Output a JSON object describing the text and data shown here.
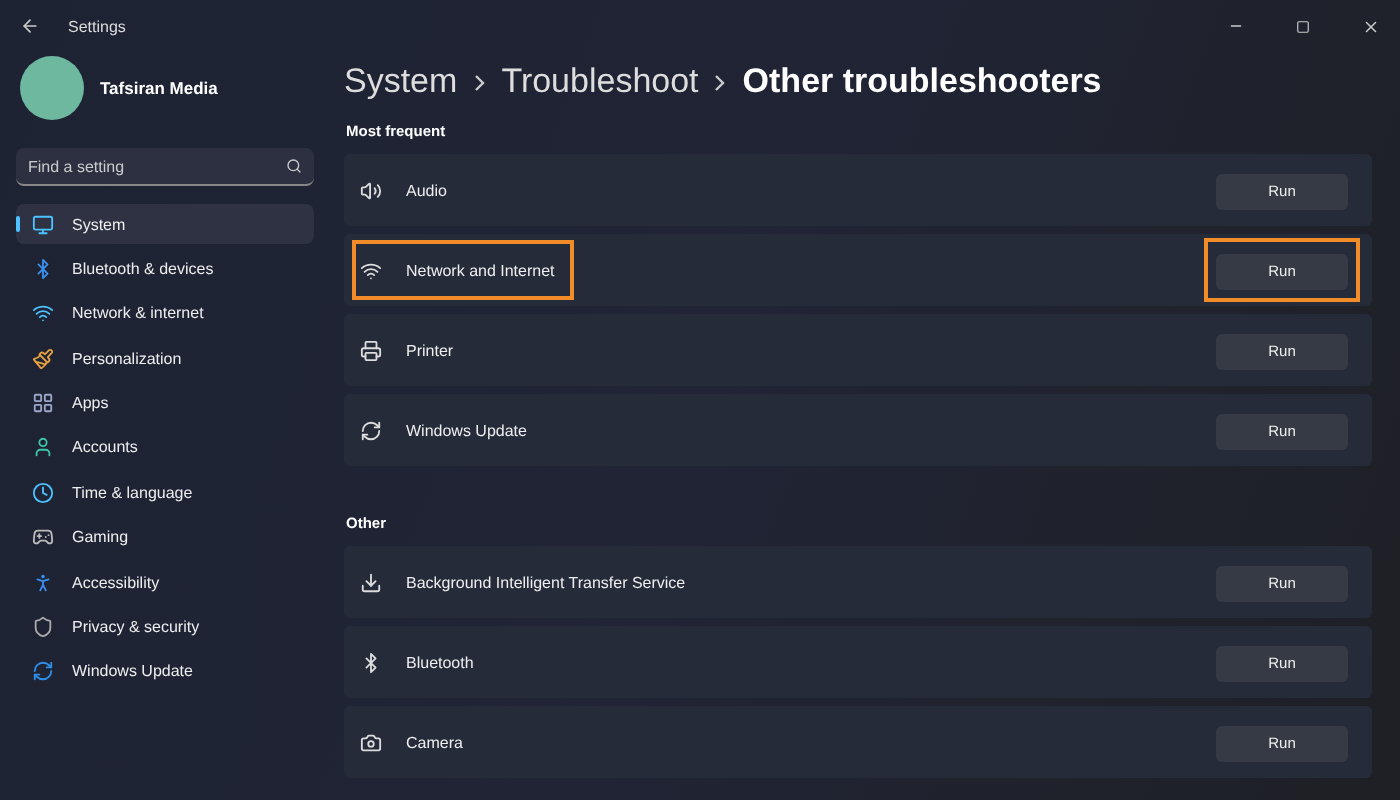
{
  "window": {
    "title": "Settings"
  },
  "profile": {
    "name": "Tafsiran Media"
  },
  "search": {
    "placeholder": "Find a setting"
  },
  "sidebar": {
    "items": [
      {
        "label": "System",
        "selected": true
      },
      {
        "label": "Bluetooth & devices",
        "selected": false
      },
      {
        "label": "Network & internet",
        "selected": false
      },
      {
        "label": "Personalization",
        "selected": false
      },
      {
        "label": "Apps",
        "selected": false
      },
      {
        "label": "Accounts",
        "selected": false
      },
      {
        "label": "Time & language",
        "selected": false
      },
      {
        "label": "Gaming",
        "selected": false
      },
      {
        "label": "Accessibility",
        "selected": false
      },
      {
        "label": "Privacy & security",
        "selected": false
      },
      {
        "label": "Windows Update",
        "selected": false
      }
    ]
  },
  "breadcrumb": [
    "System",
    "Troubleshoot",
    "Other troubleshooters"
  ],
  "sections": [
    {
      "title": "Most frequent",
      "items": [
        {
          "label": "Audio",
          "button": "Run",
          "highlighted": false
        },
        {
          "label": "Network and Internet",
          "button": "Run",
          "highlighted": true
        },
        {
          "label": "Printer",
          "button": "Run",
          "highlighted": false
        },
        {
          "label": "Windows Update",
          "button": "Run",
          "highlighted": false
        }
      ]
    },
    {
      "title": "Other",
      "items": [
        {
          "label": "Background Intelligent Transfer Service",
          "button": "Run",
          "highlighted": false
        },
        {
          "label": "Bluetooth",
          "button": "Run",
          "highlighted": false
        },
        {
          "label": "Camera",
          "button": "Run",
          "highlighted": false
        }
      ]
    }
  ]
}
